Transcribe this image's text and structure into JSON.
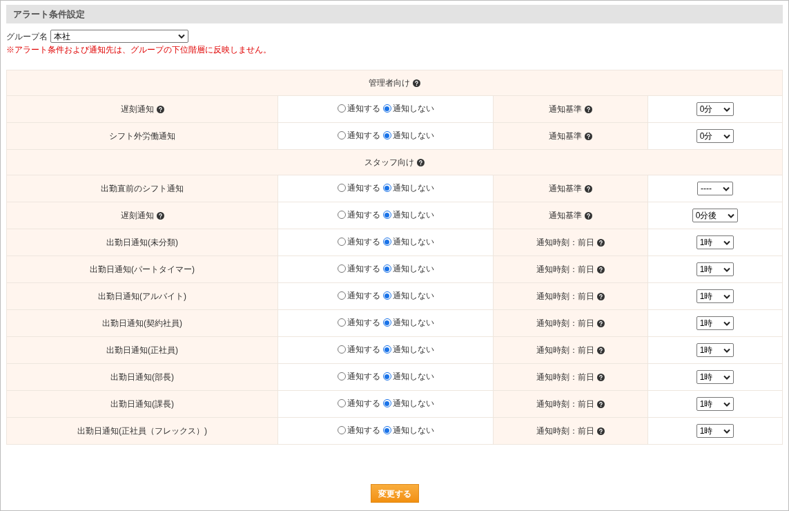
{
  "page_title": "アラート条件設定",
  "group": {
    "label": "グループ名",
    "value": "本社"
  },
  "notice": "※アラート条件および通知先は、グループの下位階層に反映しません。",
  "sections": [
    {
      "title": "管理者向け",
      "help": true,
      "rows": [
        {
          "label": "遅刻通知",
          "help": true,
          "options": [
            {
              "label": "通知する",
              "selected": false
            },
            {
              "label": "通知しない",
              "selected": true
            }
          ],
          "criterion": "通知基準",
          "criterion_help": true,
          "select": "0分"
        },
        {
          "label": "シフト外労働通知",
          "help": false,
          "options": [
            {
              "label": "通知する",
              "selected": false
            },
            {
              "label": "通知しない",
              "selected": true
            }
          ],
          "criterion": "通知基準",
          "criterion_help": true,
          "select": "0分"
        }
      ]
    },
    {
      "title": "スタッフ向け",
      "help": true,
      "rows": [
        {
          "label": "出勤直前のシフト通知",
          "help": false,
          "options": [
            {
              "label": "通知する",
              "selected": false
            },
            {
              "label": "通知しない",
              "selected": true
            }
          ],
          "criterion": "通知基準",
          "criterion_help": true,
          "select": "----"
        },
        {
          "label": "遅刻通知",
          "help": true,
          "options": [
            {
              "label": "通知する",
              "selected": false
            },
            {
              "label": "通知しない",
              "selected": true
            }
          ],
          "criterion": "通知基準",
          "criterion_help": true,
          "select": "0分後"
        },
        {
          "label": "出勤日通知(未分類)",
          "help": false,
          "options": [
            {
              "label": "通知する",
              "selected": false
            },
            {
              "label": "通知しない",
              "selected": true
            }
          ],
          "criterion": "通知時刻：前日",
          "criterion_help": true,
          "select": "1時"
        },
        {
          "label": "出勤日通知(パートタイマー)",
          "help": false,
          "options": [
            {
              "label": "通知する",
              "selected": false
            },
            {
              "label": "通知しない",
              "selected": true
            }
          ],
          "criterion": "通知時刻：前日",
          "criterion_help": true,
          "select": "1時"
        },
        {
          "label": "出勤日通知(アルバイト)",
          "help": false,
          "options": [
            {
              "label": "通知する",
              "selected": false
            },
            {
              "label": "通知しない",
              "selected": true
            }
          ],
          "criterion": "通知時刻：前日",
          "criterion_help": true,
          "select": "1時"
        },
        {
          "label": "出勤日通知(契約社員)",
          "help": false,
          "options": [
            {
              "label": "通知する",
              "selected": false
            },
            {
              "label": "通知しない",
              "selected": true
            }
          ],
          "criterion": "通知時刻：前日",
          "criterion_help": true,
          "select": "1時"
        },
        {
          "label": "出勤日通知(正社員)",
          "help": false,
          "options": [
            {
              "label": "通知する",
              "selected": false
            },
            {
              "label": "通知しない",
              "selected": true
            }
          ],
          "criterion": "通知時刻：前日",
          "criterion_help": true,
          "select": "1時"
        },
        {
          "label": "出勤日通知(部長)",
          "help": false,
          "options": [
            {
              "label": "通知する",
              "selected": false
            },
            {
              "label": "通知しない",
              "selected": true
            }
          ],
          "criterion": "通知時刻：前日",
          "criterion_help": true,
          "select": "1時"
        },
        {
          "label": "出勤日通知(課長)",
          "help": false,
          "options": [
            {
              "label": "通知する",
              "selected": false
            },
            {
              "label": "通知しない",
              "selected": true
            }
          ],
          "criterion": "通知時刻：前日",
          "criterion_help": true,
          "select": "1時"
        },
        {
          "label": "出勤日通知(正社員（フレックス）)",
          "help": false,
          "options": [
            {
              "label": "通知する",
              "selected": false
            },
            {
              "label": "通知しない",
              "selected": true
            }
          ],
          "criterion": "通知時刻：前日",
          "criterion_help": true,
          "select": "1時"
        }
      ]
    }
  ],
  "submit": "変更する"
}
